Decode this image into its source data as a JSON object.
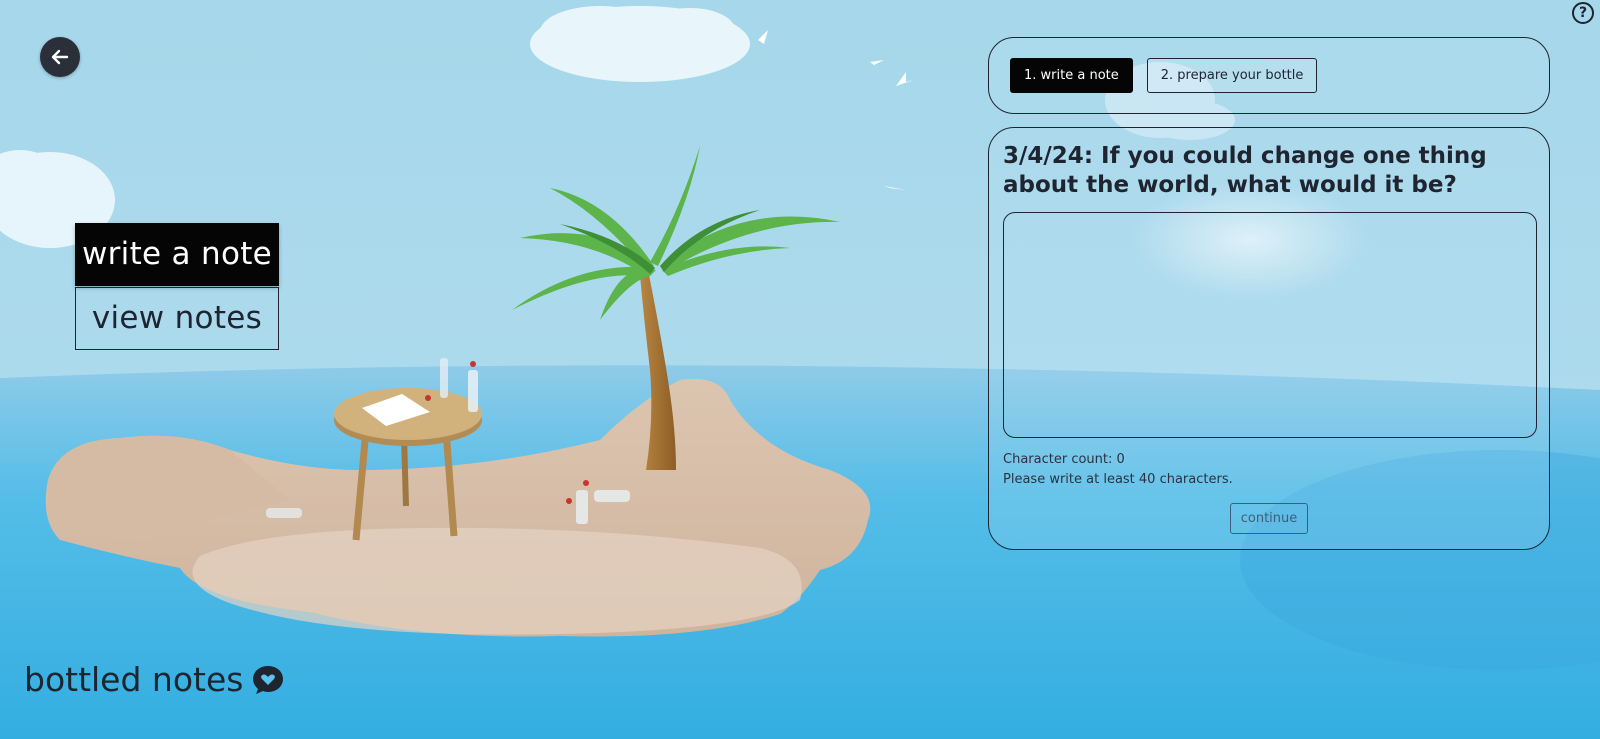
{
  "header": {
    "back_icon": "arrow-left-icon",
    "help_label": "?"
  },
  "menu": {
    "write_label": "write a note",
    "view_label": "view notes"
  },
  "brand": {
    "name": "bottled notes",
    "icon": "chat-heart-icon"
  },
  "steps": [
    {
      "label": "1. write a note",
      "active": true
    },
    {
      "label": "2. prepare your bottle",
      "active": false
    }
  ],
  "form": {
    "prompt": "3/4/24: If you could change one thing about the world, what would it be?",
    "note_value": "",
    "char_count_text": "Character count: 0",
    "hint_text": "Please write at least 40 characters.",
    "continue_label": "continue"
  },
  "colors": {
    "sky": "#a9d8ea",
    "sea": "#3fb3e3",
    "sand": "#d9c2ad",
    "accent_dark": "#050505"
  }
}
